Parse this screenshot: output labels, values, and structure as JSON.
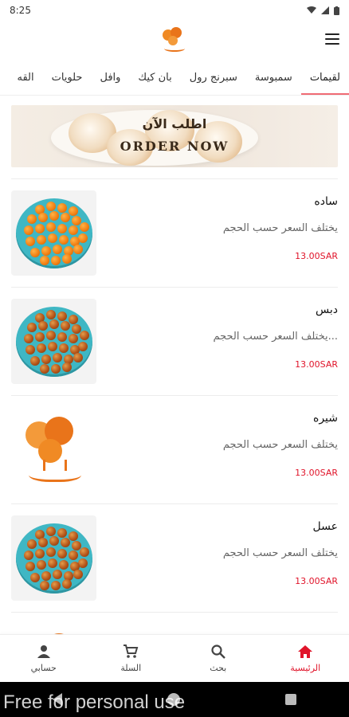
{
  "status_bar": {
    "time": "8:25",
    "wifi_icon": "wifi-icon",
    "signal_icon": "signal-icon",
    "battery_icon": "battery-icon"
  },
  "app_bar": {
    "logo_icon": "brand-logo",
    "menu_icon": "hamburger-menu-icon"
  },
  "categories": [
    {
      "label": "لقيمات",
      "active": true
    },
    {
      "label": "سمبوسة",
      "active": false
    },
    {
      "label": "سبرنج رول",
      "active": false
    },
    {
      "label": "بان كيك",
      "active": false
    },
    {
      "label": "وافل",
      "active": false
    },
    {
      "label": "حلويات",
      "active": false
    },
    {
      "label": "القه",
      "active": false
    }
  ],
  "banner": {
    "arabic_text": "اطلب الآن",
    "english_text": "ORDER NOW"
  },
  "products": [
    {
      "name": "ساده",
      "description": "يختلف السعر حسب الحجم",
      "price": "13.00SAR",
      "image": "plain-luqaimat"
    },
    {
      "name": "دبس",
      "description": "...يختلف السعر حسب الحجم",
      "price": "13.00SAR",
      "image": "glazed-luqaimat"
    },
    {
      "name": "شيره",
      "description": "يختلف السعر حسب الحجم",
      "price": "13.00SAR",
      "image": "brand-logo"
    },
    {
      "name": "عسل",
      "description": "يختلف السعر حسب الحجم",
      "price": "13.00SAR",
      "image": "glazed-luqaimat"
    },
    {
      "name": "",
      "description": "",
      "price": "",
      "image": "brand-logo"
    }
  ],
  "bottom_nav": [
    {
      "label": "الرئيسية",
      "icon": "home-icon",
      "active": true
    },
    {
      "label": "بحث",
      "icon": "search-icon",
      "active": false
    },
    {
      "label": "السلة",
      "icon": "cart-icon",
      "active": false
    },
    {
      "label": "حسابي",
      "icon": "person-icon",
      "active": false
    }
  ],
  "watermark": "Free for personal use",
  "colors": {
    "accent": "#e0142a",
    "tab_indicator": "#f06b74",
    "brand_orange": "#f08a24"
  }
}
